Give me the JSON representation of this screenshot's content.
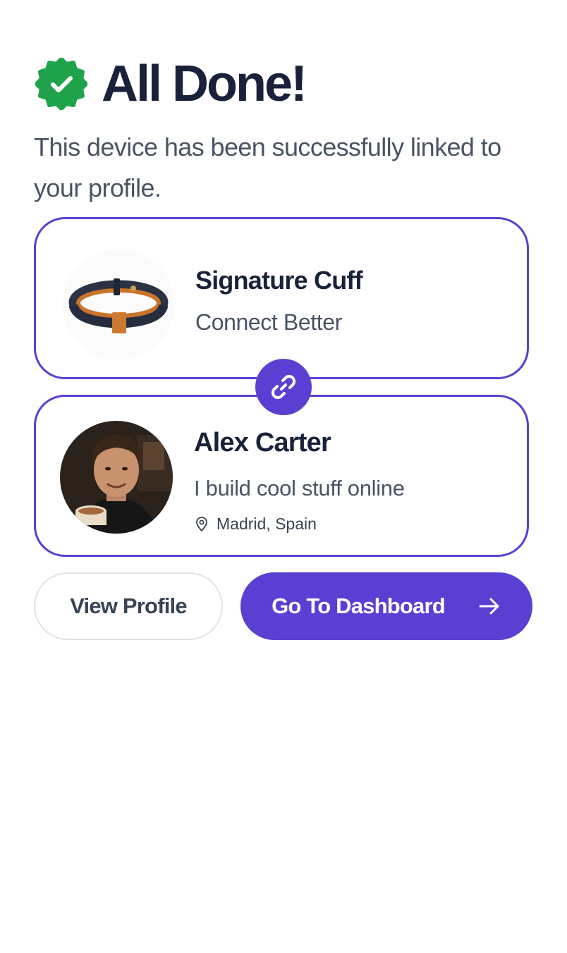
{
  "header": {
    "title": "All Done!",
    "subtitle": "This device has been successfully linked to your profile.",
    "badge_icon": "verified-badge-check-icon",
    "badge_color": "#1fa34a"
  },
  "device": {
    "name": "Signature Cuff",
    "tagline": "Connect Better",
    "image": "leather-cuff-bracelet"
  },
  "link_badge": {
    "icon": "link-icon",
    "color": "#5b3fd2"
  },
  "profile": {
    "name": "Alex Carter",
    "bio": "I build cool stuff online",
    "location": "Madrid, Spain",
    "location_icon": "map-pin-icon",
    "avatar": "profile-photo"
  },
  "actions": {
    "view_profile_label": "View Profile",
    "dashboard_label": "Go To Dashboard",
    "dashboard_icon": "arrow-right-icon"
  },
  "colors": {
    "accent": "#5b3fd2",
    "success": "#1fa34a",
    "heading": "#19223a",
    "body_text": "#4a5363"
  }
}
